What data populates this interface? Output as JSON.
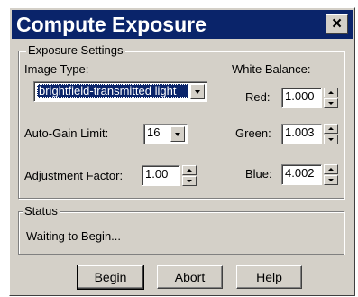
{
  "window": {
    "title": "Compute Exposure",
    "close_glyph": "×"
  },
  "exposure_settings": {
    "legend": "Exposure Settings",
    "image_type": {
      "label": "Image Type:",
      "value": "brightfield-transmitted light"
    },
    "auto_gain_limit": {
      "label": "Auto-Gain Limit:",
      "value": "16"
    },
    "adjustment_factor": {
      "label": "Adjustment Factor:",
      "value": "1.00"
    },
    "white_balance": {
      "label": "White Balance:",
      "red": {
        "label": "Red:",
        "value": "1.000"
      },
      "green": {
        "label": "Green:",
        "value": "1.003"
      },
      "blue": {
        "label": "Blue:",
        "value": "4.002"
      }
    }
  },
  "status": {
    "legend": "Status",
    "text": "Waiting to Begin..."
  },
  "buttons": {
    "begin": "Begin",
    "abort": "Abort",
    "help": "Help"
  },
  "colors": {
    "titlebar": "#0a246a",
    "face": "#d4d0c8",
    "selection": "#0a246a"
  },
  "icons": {
    "close": "close-icon",
    "dropdown": "chevron-down-icon",
    "spin_up": "arrow-up-icon",
    "spin_down": "arrow-down-icon"
  }
}
